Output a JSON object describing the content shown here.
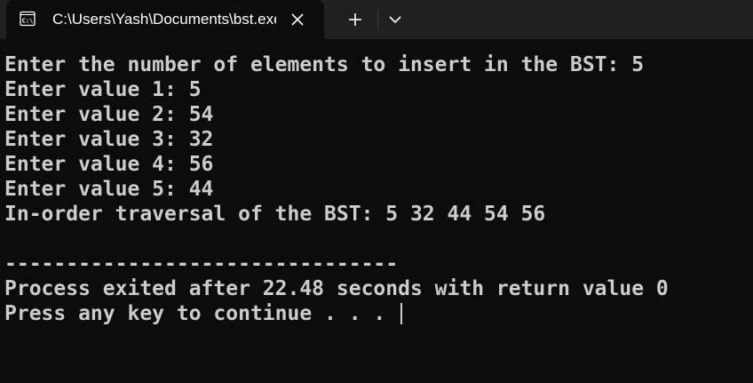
{
  "tab": {
    "title": "C:\\Users\\Yash\\Documents\\bst.exe",
    "icon": "terminal-icon",
    "close_icon": "close-icon"
  },
  "toolbar": {
    "new_tab_icon": "plus-icon",
    "dropdown_icon": "chevron-down-icon"
  },
  "console": {
    "lines": [
      "Enter the number of elements to insert in the BST: 5",
      "Enter value 1: 5",
      "Enter value 2: 54",
      "Enter value 3: 32",
      "Enter value 4: 56",
      "Enter value 5: 44",
      "In-order traversal of the BST: 5 32 44 54 56",
      "",
      "--------------------------------",
      "Process exited after 22.48 seconds with return value 0",
      "Press any key to continue . . . "
    ]
  },
  "colors": {
    "background": "#0c0c0c",
    "tabbar": "#202020",
    "text": "#cccccc"
  }
}
